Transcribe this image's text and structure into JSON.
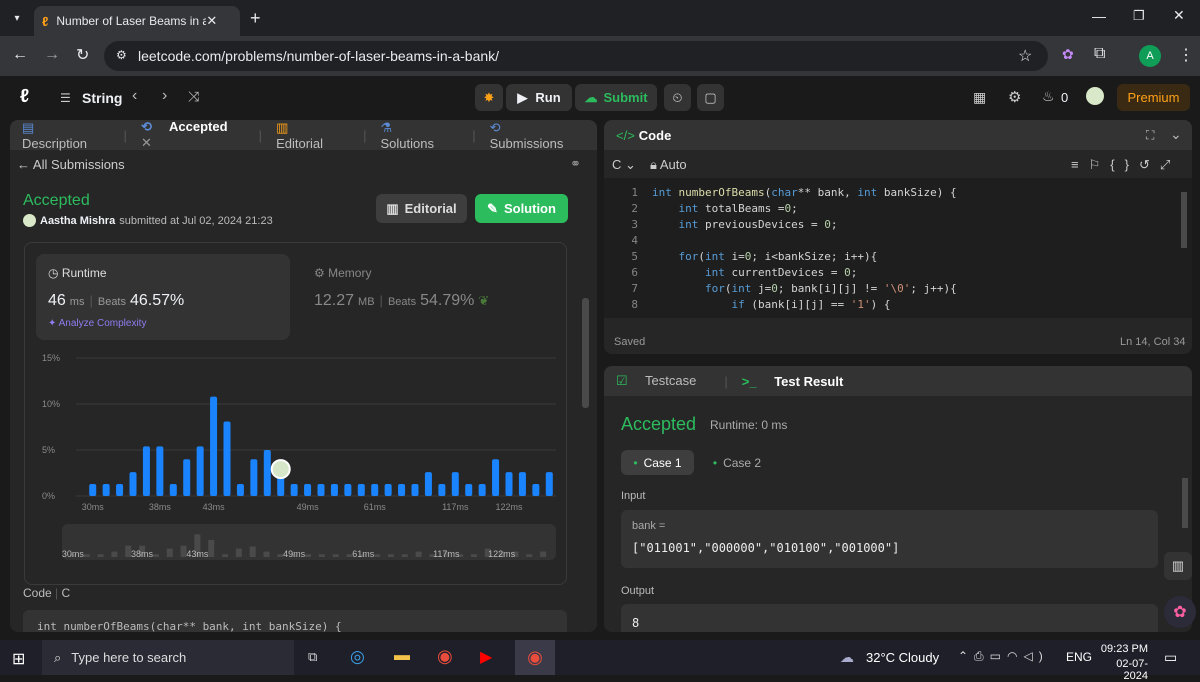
{
  "browser": {
    "tab_title": "Number of Laser Beams in a Ba",
    "url": "leetcode.com/problems/number-of-laser-beams-in-a-bank/",
    "profile_initial": "A"
  },
  "header": {
    "topic": "String",
    "run_label": "Run",
    "submit_label": "Submit",
    "streak": "0",
    "premium_label": "Premium"
  },
  "left": {
    "tabs": {
      "description": "Description",
      "accepted": "Accepted",
      "editorial": "Editorial",
      "solutions": "Solutions",
      "submissions": "Submissions"
    },
    "back_label": "All Submissions",
    "status": "Accepted",
    "user": "Aastha Mishra",
    "submitted_text": "submitted at Jul 02, 2024 21:23",
    "editorial_btn": "Editorial",
    "solution_btn": "Solution",
    "runtime": {
      "label": "Runtime",
      "value": "46",
      "unit": "ms",
      "beats_label": "Beats",
      "beats": "46.57%",
      "analyze": "Analyze Complexity"
    },
    "memory": {
      "label": "Memory",
      "value": "12.27",
      "unit": "MB",
      "beats_label": "Beats",
      "beats": "54.79%"
    },
    "code_label": "Code",
    "lang": "C",
    "code_preview": "int numberOfBeams(char** bank, int bankSize) {"
  },
  "chart_data": {
    "type": "bar",
    "ylim": [
      0,
      15
    ],
    "yticks": [
      "15%",
      "10%",
      "5%",
      "0%"
    ],
    "xticks": [
      "30ms",
      "38ms",
      "43ms",
      "49ms",
      "61ms",
      "117ms",
      "122ms"
    ],
    "values": [
      1.3,
      1.3,
      1.3,
      2.6,
      5.4,
      5.4,
      1.3,
      4,
      5.4,
      10.8,
      8.1,
      1.3,
      4,
      5,
      2.6,
      1.3,
      1.3,
      1.3,
      1.3,
      1.3,
      1.3,
      1.3,
      1.3,
      1.3,
      1.3,
      2.6,
      1.3,
      2.6,
      1.3,
      1.3,
      4,
      2.6,
      2.6,
      1.3,
      2.6
    ],
    "highlight_index": 14,
    "bar_color": "#1a84ff",
    "mini_xticks": [
      "30ms",
      "38ms",
      "43ms",
      "49ms",
      "61ms",
      "117ms",
      "122ms"
    ]
  },
  "right": {
    "code_title": "Code",
    "lang": "C",
    "mode": "Auto",
    "code_lines": [
      "int numberOfBeams(char** bank, int bankSize) {",
      "    int totalBeams =0;",
      "    int previousDevices = 0;",
      "",
      "    for(int i=0; i<bankSize; i++){",
      "        int currentDevices = 0;",
      "        for(int j=0; bank[i][j] != '\\0'; j++){",
      "            if (bank[i][j] == '1') {"
    ],
    "line_numbers": [
      "1",
      "2",
      "3",
      "4",
      "5",
      "6",
      "7",
      "8"
    ],
    "saved": "Saved",
    "cursor": "Ln 14, Col 34",
    "testcase_tab": "Testcase",
    "result_tab": "Test Result",
    "result_status": "Accepted",
    "result_runtime": "Runtime: 0 ms",
    "case1": "Case 1",
    "case2": "Case 2",
    "input_label": "Input",
    "input_var": "bank =",
    "input_value": "[\"011001\",\"000000\",\"010100\",\"001000\"]",
    "output_label": "Output",
    "output_value": "8"
  },
  "taskbar": {
    "search_placeholder": "Type here to search",
    "weather": "32°C  Cloudy",
    "lang": "ENG",
    "time": "09:23 PM",
    "date": "02-07-2024"
  }
}
